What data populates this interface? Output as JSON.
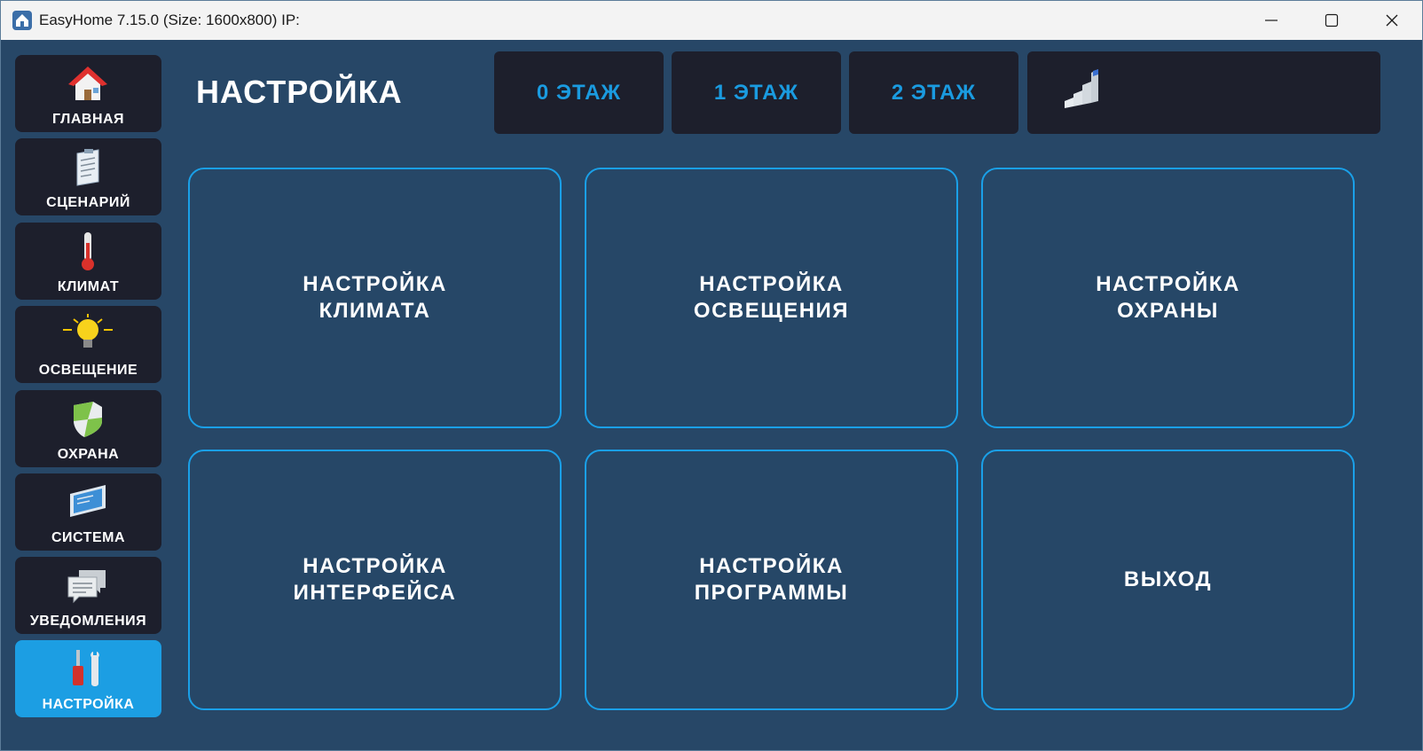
{
  "window": {
    "title": "EasyHome 7.15.0 (Size: 1600x800) IP:"
  },
  "sidebar": {
    "items": [
      {
        "label": "ГЛАВНАЯ",
        "icon": "house-icon"
      },
      {
        "label": "СЦЕНАРИЙ",
        "icon": "clipboard-icon"
      },
      {
        "label": "КЛИМАТ",
        "icon": "thermometer-icon"
      },
      {
        "label": "ОСВЕЩЕНИЕ",
        "icon": "lightbulb-icon"
      },
      {
        "label": "ОХРАНА",
        "icon": "shield-icon"
      },
      {
        "label": "СИСТЕМА",
        "icon": "monitor-icon"
      },
      {
        "label": "УВЕДОМЛЕНИЯ",
        "icon": "chat-bubbles-icon"
      },
      {
        "label": "НАСТРОЙКА",
        "icon": "tools-icon",
        "active": true
      }
    ]
  },
  "header": {
    "title": "НАСТРОЙКА",
    "floors": [
      "0 ЭТАЖ",
      "1 ЭТАЖ",
      "2 ЭТАЖ"
    ],
    "extra_icon": "stairs-icon"
  },
  "tiles": [
    {
      "line1": "НАСТРОЙКА",
      "line2": "КЛИМАТА"
    },
    {
      "line1": "НАСТРОЙКА",
      "line2": "ОСВЕЩЕНИЯ"
    },
    {
      "line1": "НАСТРОЙКА",
      "line2": "ОХРАНЫ"
    },
    {
      "line1": "НАСТРОЙКА",
      "line2": "ИНТЕРФЕЙСА"
    },
    {
      "line1": "НАСТРОЙКА",
      "line2": "ПРОГРАММЫ"
    },
    {
      "line1": "ВЫХОД",
      "line2": ""
    }
  ],
  "colors": {
    "background": "#274767",
    "panel": "#1d1f2c",
    "accent": "#1c9ee3",
    "tile_border": "#1aa0e8"
  }
}
